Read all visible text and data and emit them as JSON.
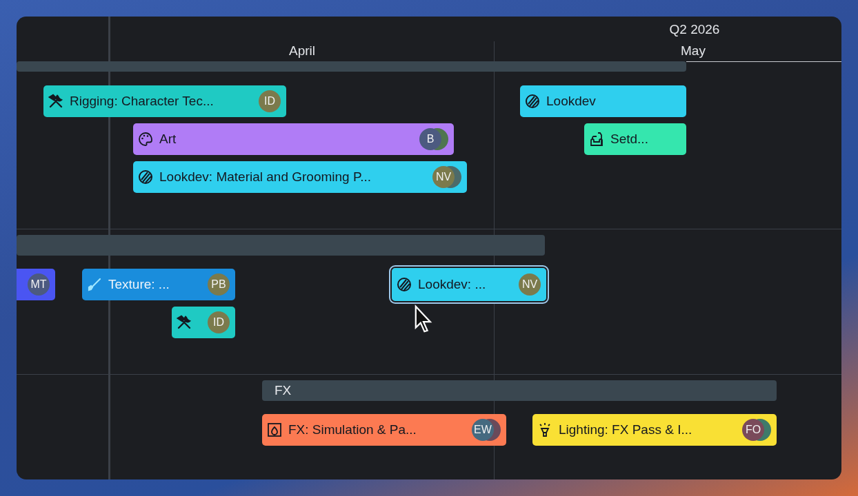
{
  "timeline": {
    "quarter": "Q2 2026",
    "months": [
      {
        "label": "April"
      },
      {
        "label": "May"
      }
    ]
  },
  "groups": [
    {
      "tasks": [
        {
          "title": "Rigging: Character Tec...",
          "kind": "rigging",
          "color": "#1fcac3",
          "selected": false,
          "avatars": [
            {
              "initials": "ID",
              "color": "#7b7a4c"
            }
          ]
        },
        {
          "title": "Art",
          "kind": "art",
          "color": "#b07cf6",
          "selected": false,
          "avatars": [
            {
              "initials": "B",
              "color": "#4c5a80"
            },
            {
              "color": "#4f7550"
            }
          ]
        },
        {
          "title": "Lookdev: Material and Grooming P...",
          "kind": "lookdev",
          "color": "#2fcfee",
          "selected": false,
          "avatars": [
            {
              "initials": "NV",
              "color": "#7b7a4c"
            },
            {
              "color": "#4c6a6a"
            }
          ]
        },
        {
          "title": "Lookdev",
          "kind": "lookdev",
          "color": "#2fcfee",
          "selected": false
        },
        {
          "title": "Setd...",
          "kind": "setdressing",
          "color": "#35e6ae",
          "selected": false
        }
      ]
    },
    {
      "tasks": [
        {
          "color": "#4a55f2",
          "selected": false,
          "avatars": [
            {
              "initials": "MT",
              "color": "#4c5a80"
            }
          ]
        },
        {
          "title": "Texture: ...",
          "kind": "texture",
          "color": "#1a8ddc",
          "selected": false,
          "avatars": [
            {
              "initials": "PB",
              "color": "#7b7a4c"
            }
          ]
        },
        {
          "kind": "rigging",
          "color": "#1fcac3",
          "selected": false,
          "avatars": [
            {
              "initials": "ID",
              "color": "#7b7a4c"
            }
          ]
        },
        {
          "title": "Lookdev: ...",
          "kind": "lookdev",
          "color": "#2fcfee",
          "selected": true,
          "avatars": [
            {
              "initials": "NV",
              "color": "#7b7a4c"
            }
          ]
        }
      ]
    },
    {
      "label": "FX",
      "tasks": [
        {
          "title": "FX: Simulation & Pa...",
          "kind": "fx",
          "color": "#fc7a52",
          "selected": false,
          "avatars": [
            {
              "initials": "EW",
              "color": "#456a80"
            },
            {
              "color": "#6a4a5a"
            }
          ]
        },
        {
          "title": "Lighting: FX Pass & I...",
          "kind": "lighting",
          "color": "#f9e034",
          "selected": false,
          "avatars": [
            {
              "initials": "FO",
              "color": "#7a4a5a"
            },
            {
              "color": "#3f7a6a"
            }
          ]
        }
      ]
    }
  ]
}
